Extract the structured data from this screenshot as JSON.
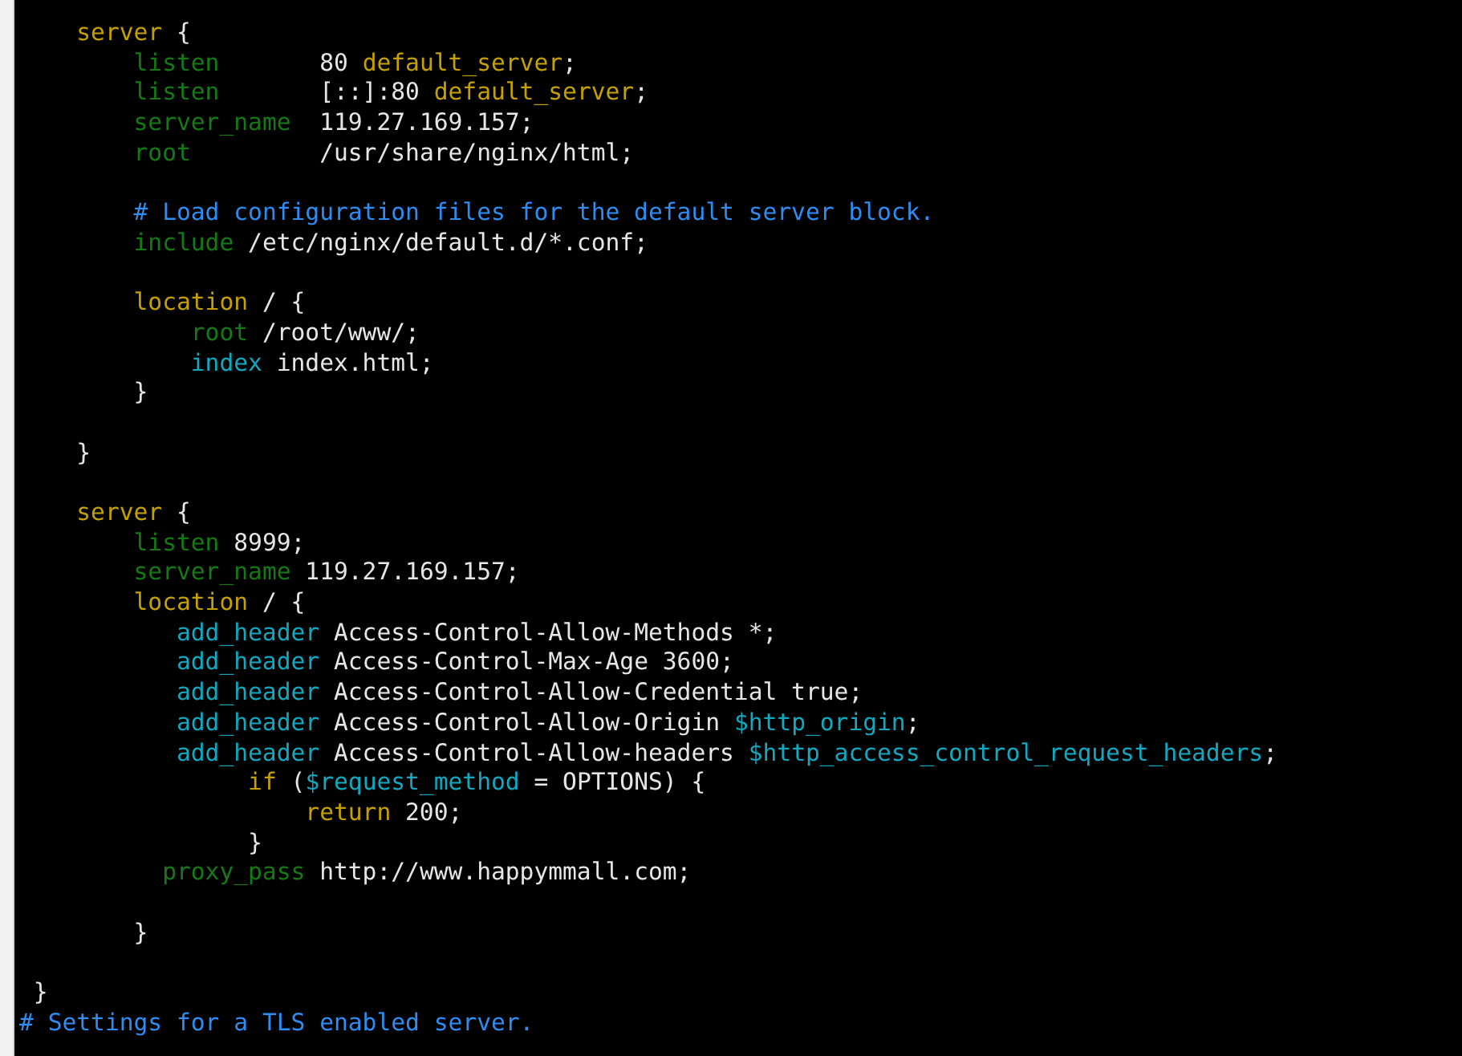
{
  "terminal": {
    "lines": [
      {
        "kind": "code",
        "segments": [
          {
            "text": "    server",
            "kind": "keyword"
          },
          {
            "text": " {",
            "kind": "plain"
          }
        ]
      },
      {
        "kind": "code",
        "segments": [
          {
            "text": "        listen",
            "kind": "directive"
          },
          {
            "text": "       80 ",
            "kind": "plain"
          },
          {
            "text": "default_server",
            "kind": "keyword"
          },
          {
            "text": ";",
            "kind": "plain"
          }
        ]
      },
      {
        "kind": "code",
        "segments": [
          {
            "text": "        listen",
            "kind": "directive"
          },
          {
            "text": "       [::]:80 ",
            "kind": "plain"
          },
          {
            "text": "default_server",
            "kind": "keyword"
          },
          {
            "text": ";",
            "kind": "plain"
          }
        ]
      },
      {
        "kind": "code",
        "segments": [
          {
            "text": "        server_name",
            "kind": "directive"
          },
          {
            "text": "  119.27.169.157;",
            "kind": "plain"
          }
        ]
      },
      {
        "kind": "code",
        "segments": [
          {
            "text": "        root",
            "kind": "directive"
          },
          {
            "text": "         /usr/share/nginx/html;",
            "kind": "plain"
          }
        ]
      },
      {
        "kind": "blank"
      },
      {
        "kind": "code",
        "segments": [
          {
            "text": "        # Load configuration files for the default server block.",
            "kind": "comment"
          }
        ]
      },
      {
        "kind": "code",
        "segments": [
          {
            "text": "        include",
            "kind": "directive"
          },
          {
            "text": " /etc/nginx/default.d/*.conf;",
            "kind": "plain"
          }
        ]
      },
      {
        "kind": "blank"
      },
      {
        "kind": "code",
        "segments": [
          {
            "text": "        location",
            "kind": "keyword"
          },
          {
            "text": " / {",
            "kind": "plain"
          }
        ]
      },
      {
        "kind": "code",
        "segments": [
          {
            "text": "            root",
            "kind": "directive"
          },
          {
            "text": " /root/www/;",
            "kind": "plain"
          }
        ]
      },
      {
        "kind": "code",
        "segments": [
          {
            "text": "            index",
            "kind": "builtin"
          },
          {
            "text": " index.html;",
            "kind": "plain"
          }
        ]
      },
      {
        "kind": "code",
        "segments": [
          {
            "text": "        }",
            "kind": "plain"
          }
        ]
      },
      {
        "kind": "blank"
      },
      {
        "kind": "code",
        "segments": [
          {
            "text": "    }",
            "kind": "plain"
          }
        ]
      },
      {
        "kind": "blank"
      },
      {
        "kind": "code",
        "segments": [
          {
            "text": "    server",
            "kind": "keyword"
          },
          {
            "text": " {",
            "kind": "plain"
          }
        ]
      },
      {
        "kind": "code",
        "segments": [
          {
            "text": "        listen",
            "kind": "directive"
          },
          {
            "text": " 8999;",
            "kind": "plain"
          }
        ]
      },
      {
        "kind": "code",
        "segments": [
          {
            "text": "        server_name",
            "kind": "directive"
          },
          {
            "text": " 119.27.169.157;",
            "kind": "plain"
          }
        ]
      },
      {
        "kind": "code",
        "segments": [
          {
            "text": "        location",
            "kind": "keyword"
          },
          {
            "text": " / {",
            "kind": "plain"
          }
        ]
      },
      {
        "kind": "code",
        "segments": [
          {
            "text": "           add_header",
            "kind": "builtin"
          },
          {
            "text": " Access-Control-Allow-Methods *;",
            "kind": "plain"
          }
        ]
      },
      {
        "kind": "code",
        "segments": [
          {
            "text": "           add_header",
            "kind": "builtin"
          },
          {
            "text": " Access-Control-Max-Age 3600;",
            "kind": "plain"
          }
        ]
      },
      {
        "kind": "code",
        "segments": [
          {
            "text": "           add_header",
            "kind": "builtin"
          },
          {
            "text": " Access-Control-Allow-Credential true;",
            "kind": "plain"
          }
        ]
      },
      {
        "kind": "code",
        "segments": [
          {
            "text": "           add_header",
            "kind": "builtin"
          },
          {
            "text": " Access-Control-Allow-Origin ",
            "kind": "plain"
          },
          {
            "text": "$http_origin",
            "kind": "builtin"
          },
          {
            "text": ";",
            "kind": "plain"
          }
        ]
      },
      {
        "kind": "code",
        "segments": [
          {
            "text": "           add_header",
            "kind": "builtin"
          },
          {
            "text": " Access-Control-Allow-headers ",
            "kind": "plain"
          },
          {
            "text": "$http_access_control_request_headers",
            "kind": "builtin"
          },
          {
            "text": ";",
            "kind": "plain"
          }
        ]
      },
      {
        "kind": "code",
        "segments": [
          {
            "text": "                if",
            "kind": "keyword"
          },
          {
            "text": " (",
            "kind": "plain"
          },
          {
            "text": "$request_method",
            "kind": "builtin"
          },
          {
            "text": " = OPTIONS) {",
            "kind": "plain"
          }
        ]
      },
      {
        "kind": "code",
        "segments": [
          {
            "text": "                    return",
            "kind": "keyword"
          },
          {
            "text": " 200;",
            "kind": "plain"
          }
        ]
      },
      {
        "kind": "code",
        "segments": [
          {
            "text": "                }",
            "kind": "plain"
          }
        ]
      },
      {
        "kind": "code",
        "segments": [
          {
            "text": "          proxy_pass",
            "kind": "directive"
          },
          {
            "text": " http://www.happymmall.com;",
            "kind": "plain"
          }
        ]
      },
      {
        "kind": "blank"
      },
      {
        "kind": "code",
        "segments": [
          {
            "text": "        }",
            "kind": "plain"
          }
        ]
      },
      {
        "kind": "blank"
      },
      {
        "kind": "code",
        "segments": [
          {
            "text": " }",
            "kind": "plain"
          }
        ]
      },
      {
        "kind": "code",
        "segments": [
          {
            "text": "# Settings for a TLS enabled server.",
            "kind": "comment"
          }
        ]
      }
    ]
  }
}
